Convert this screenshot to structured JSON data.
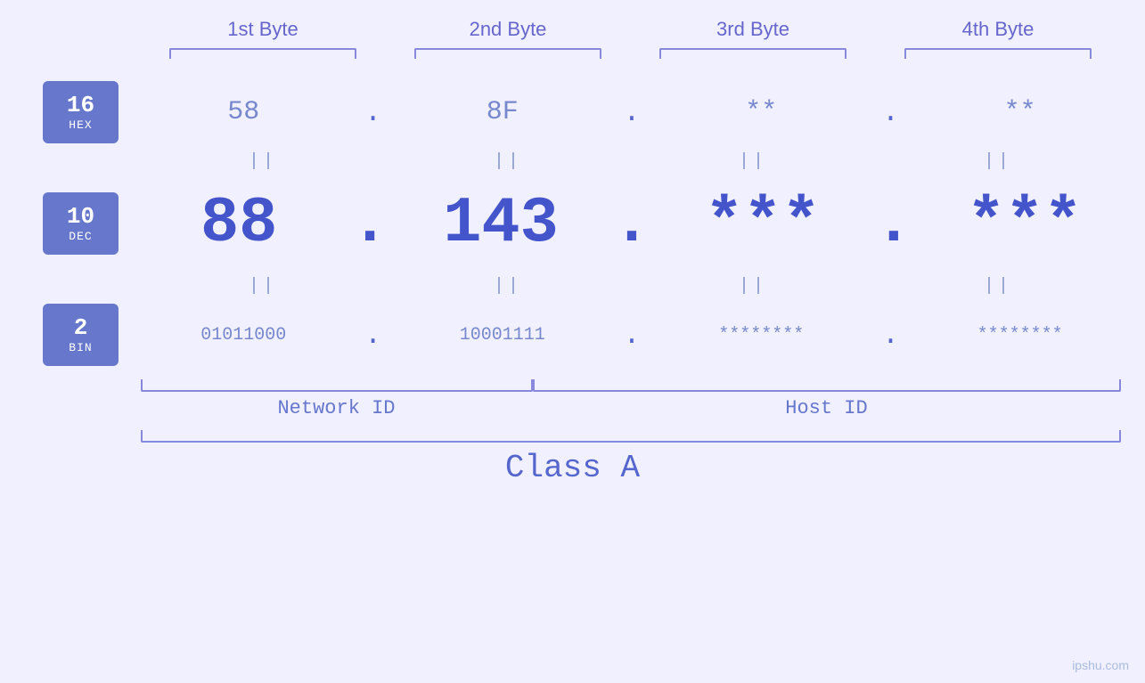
{
  "headers": {
    "byte1": "1st Byte",
    "byte2": "2nd Byte",
    "byte3": "3rd Byte",
    "byte4": "4th Byte"
  },
  "labels": {
    "hex_num": "16",
    "hex_text": "HEX",
    "dec_num": "10",
    "dec_text": "DEC",
    "bin_num": "2",
    "bin_text": "BIN"
  },
  "hex_row": {
    "b1": "58",
    "b2": "8F",
    "b3": "**",
    "b4": "**",
    "dots": [
      ".",
      ".",
      ".",
      ""
    ]
  },
  "dec_row": {
    "b1": "88",
    "b2": "143",
    "b3": "***",
    "b4": "***",
    "dots": [
      ".",
      ".",
      ".",
      ""
    ]
  },
  "bin_row": {
    "b1": "01011000",
    "b2": "10001111",
    "b3": "********",
    "b4": "********",
    "dots": [
      ".",
      ".",
      ".",
      ""
    ]
  },
  "bottom": {
    "network_id": "Network ID",
    "host_id": "Host ID",
    "class": "Class A"
  },
  "watermark": "ipshu.com"
}
